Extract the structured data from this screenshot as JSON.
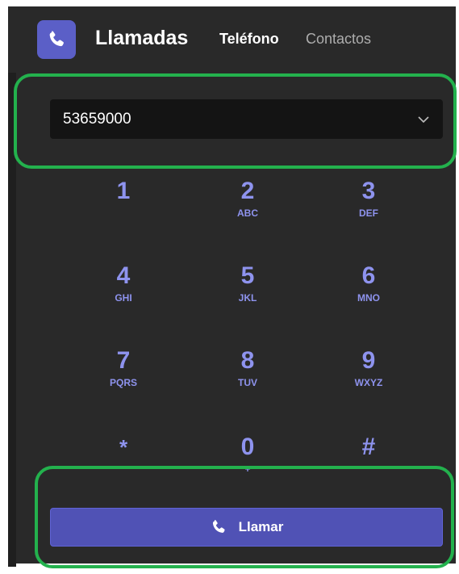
{
  "header": {
    "title": "Llamadas",
    "tabs": [
      {
        "label": "Teléfono",
        "active": true
      },
      {
        "label": "Contactos",
        "active": false
      }
    ],
    "icon": "phone-icon"
  },
  "dialer": {
    "number_value": "53659000",
    "keys": [
      {
        "digit": "1",
        "letters": ""
      },
      {
        "digit": "2",
        "letters": "ABC"
      },
      {
        "digit": "3",
        "letters": "DEF"
      },
      {
        "digit": "4",
        "letters": "GHI"
      },
      {
        "digit": "5",
        "letters": "JKL"
      },
      {
        "digit": "6",
        "letters": "MNO"
      },
      {
        "digit": "7",
        "letters": "PQRS"
      },
      {
        "digit": "8",
        "letters": "TUV"
      },
      {
        "digit": "9",
        "letters": "WXYZ"
      },
      {
        "digit": "*",
        "letters": ""
      },
      {
        "digit": "0",
        "letters": "+"
      },
      {
        "digit": "#",
        "letters": ""
      }
    ],
    "call_label": "Llamar"
  },
  "colors": {
    "accent": "#5b5fc7",
    "key_color": "#8e93ee",
    "highlight": "#23b14d",
    "background": "#292929"
  }
}
